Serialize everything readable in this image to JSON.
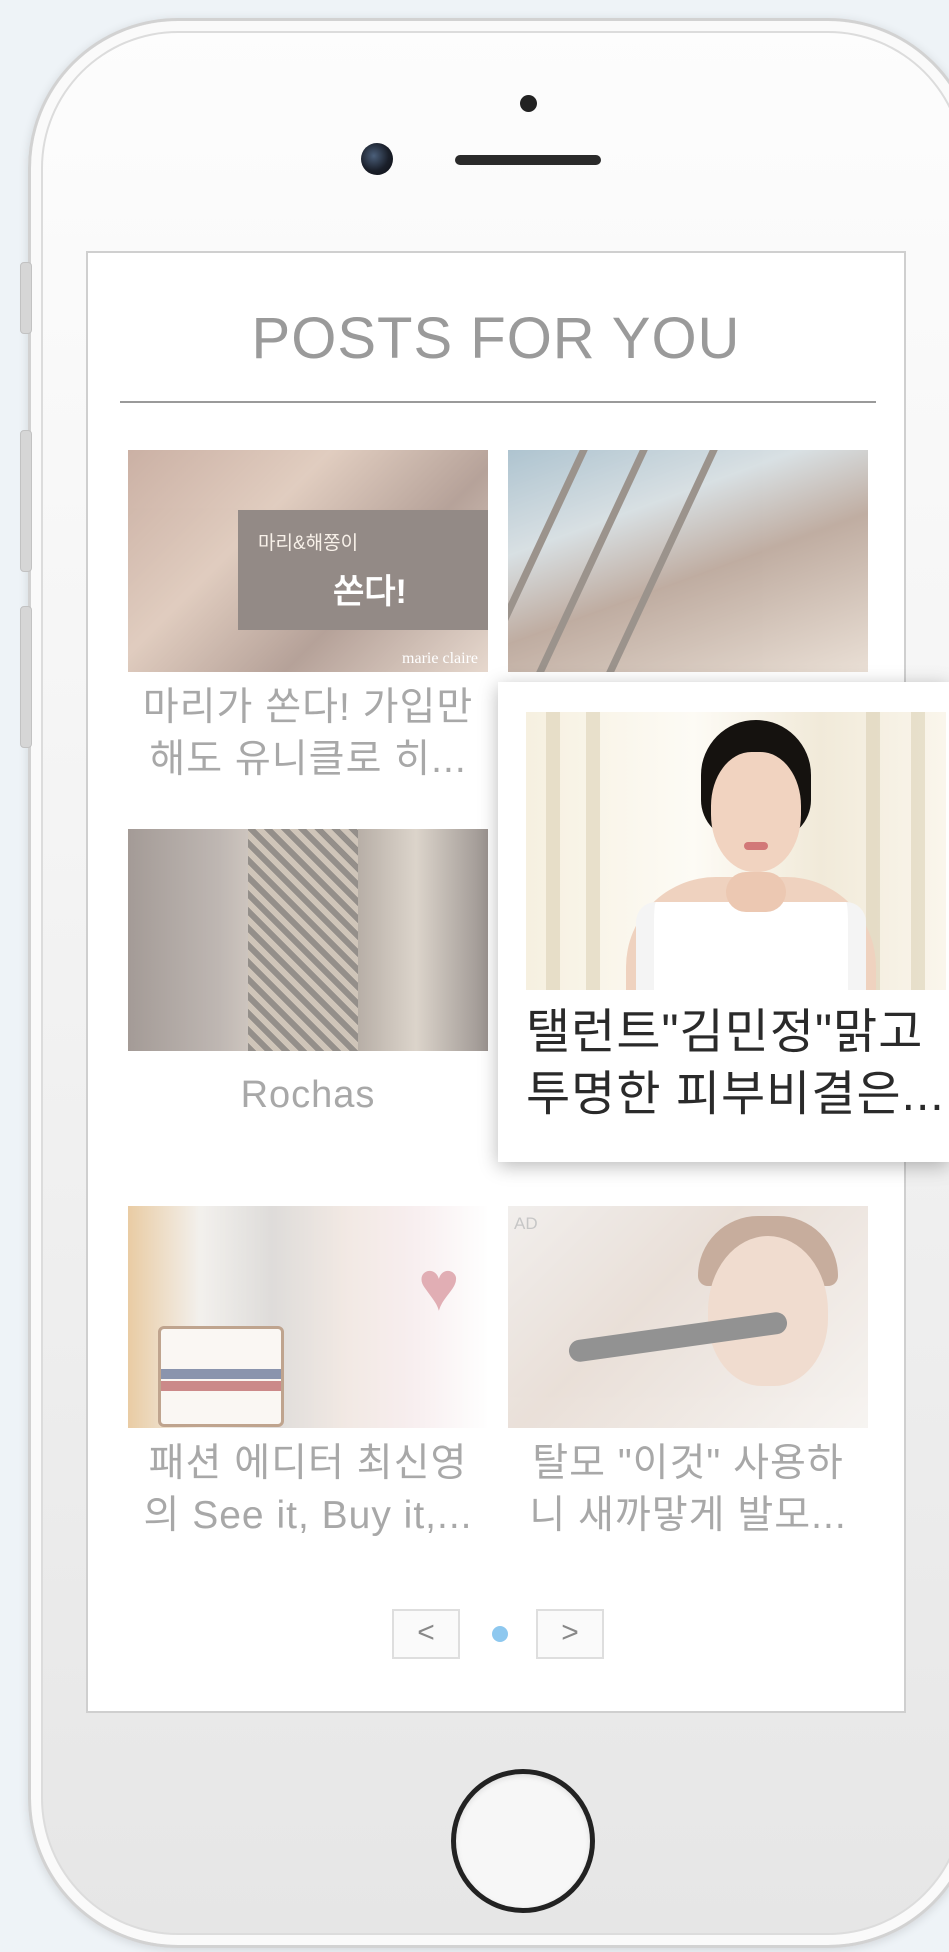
{
  "widget": {
    "title": "POSTS FOR YOU"
  },
  "posts": [
    {
      "image": "marie claire banner with knitwear",
      "caption_line1": "마리가 쏜다! 가입만",
      "caption_line2": "해도 유니클로 히...",
      "banner_line1": "마리&해쫑이",
      "banner_line2": "쏜다!",
      "watermark": "marie claire"
    },
    {
      "image": "woman lounging by window",
      "caption_line1": "",
      "caption_line2": ""
    },
    {
      "image": "runway patterned coat",
      "caption_line1": "Rochas",
      "caption_line2": ""
    },
    {
      "image": "fashion collage with bag and heart",
      "caption_line1": "패션 에디터 최신영",
      "caption_line2": "의 See it, Buy it,..."
    },
    {
      "image": "woman with hairbrush",
      "caption_line1": "탈모 \"이것\" 사용하",
      "caption_line2": "니 새까맣게 발모...",
      "ad_label": "AD"
    }
  ],
  "popup": {
    "caption_line1": "탤런트\"김민정\"맑고",
    "caption_line2": "투명한 피부비결은..."
  },
  "pager": {
    "prev": "<",
    "next": ">",
    "pages": 1,
    "active": 1
  },
  "colors": {
    "title": "#9a9a9a",
    "caption": "#a8a8a8",
    "dot": "#8ec8ef"
  }
}
